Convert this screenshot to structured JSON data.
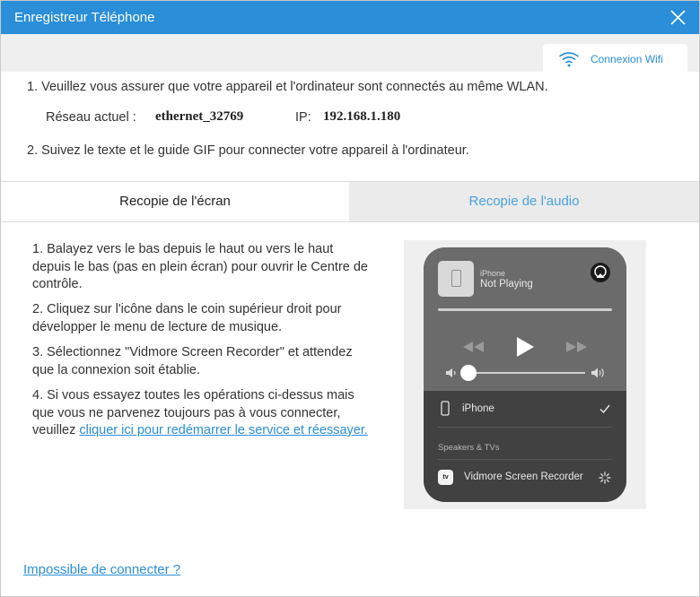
{
  "window": {
    "title": "Enregistreur Téléphone",
    "close_icon": "close-icon"
  },
  "wifi_tab": {
    "label": "Connexion Wifi",
    "icon": "wifi-icon"
  },
  "steps": {
    "step1": "1. Veuillez vous assurer que votre appareil et l'ordinateur sont connectés au même WLAN.",
    "network_label": "Réseau actuel :",
    "network_value": "ethernet_32769",
    "ip_label": "IP:",
    "ip_value": "192.168.1.180",
    "step2": "2. Suivez le texte et le guide GIF pour connecter votre appareil à l'ordinateur."
  },
  "tabs": [
    {
      "label": "Recopie de l'écran",
      "active": true
    },
    {
      "label": "Recopie de l'audio",
      "active": false
    }
  ],
  "instructions": {
    "i1": "1. Balayez vers le bas depuis le haut ou vers le haut depuis le bas (pas en plein écran) pour ouvrir le Centre de contrôle.",
    "i2": "2. Cliquez sur l'icône dans le coin supérieur droit pour développer le menu de lecture de musique.",
    "i3": "3. Sélectionnez \"Vidmore Screen Recorder\" et attendez que la connexion soit établie.",
    "i4_prefix": "4. Si vous essayez toutes les opérations ci-dessus mais que vous ne parvenez toujours pas à vous connecter, veuillez ",
    "i4_link": "cliquer ici pour redémarrer le service et réessayer."
  },
  "guide_gif": {
    "device_small": "iPhone",
    "now_playing": "Not Playing",
    "device_row": "iPhone",
    "section_header": "Speakers & TVs",
    "tv_badge": "tv",
    "receiver": "Vidmore Screen Recorder"
  },
  "footer": {
    "link": "Impossible de connecter ?"
  },
  "colors": {
    "accent": "#2a8ed8",
    "link": "#2a8ed8",
    "inactive_tab_text": "#4aa3df"
  }
}
